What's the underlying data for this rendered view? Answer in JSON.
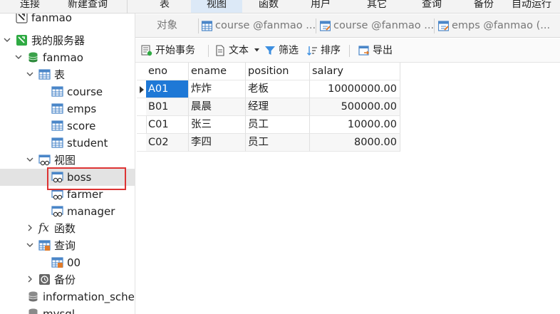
{
  "menubar": {
    "items": [
      {
        "label": "连接"
      },
      {
        "label": "新建查询"
      },
      {
        "label": "表"
      },
      {
        "label": "视图"
      },
      {
        "label": "函数"
      },
      {
        "label": "用户"
      },
      {
        "label": "其它"
      },
      {
        "label": "查询"
      },
      {
        "label": "备份"
      },
      {
        "label": "自动运行"
      }
    ],
    "active": "视图"
  },
  "sidebar": {
    "connection": "fanmao",
    "server_group": "我的服务器",
    "database": "fanmao",
    "tables_folder": "表",
    "tables": [
      "course",
      "emps",
      "score",
      "student"
    ],
    "views_folder": "视图",
    "views": [
      "boss",
      "farmer",
      "manager"
    ],
    "selected_view": "boss",
    "functions_folder": "函数",
    "queries_folder": "查询",
    "queries": [
      "00"
    ],
    "backups_folder": "备份",
    "other_databases": [
      "information_scher",
      "mysql"
    ]
  },
  "tabs": [
    {
      "label": "对象",
      "icon": "object-icon"
    },
    {
      "label": "course @fanmao ...",
      "icon": "table-icon"
    },
    {
      "label": "course @fanmao ...",
      "icon": "table-design-icon"
    },
    {
      "label": "emps @fanmao (...",
      "icon": "table-design-icon"
    }
  ],
  "toolbar": {
    "begin_transaction": "开始事务",
    "text": "文本",
    "filter": "筛选",
    "sort": "排序",
    "export": "导出"
  },
  "grid": {
    "columns": [
      "eno",
      "ename",
      "position",
      "salary"
    ],
    "rows": [
      {
        "eno": "A01",
        "ename": "炸炸",
        "position": "老板",
        "salary": "10000000.00"
      },
      {
        "eno": "B01",
        "ename": "晨晨",
        "position": "经理",
        "salary": "500000.00"
      },
      {
        "eno": "C01",
        "ename": "张三",
        "position": "员工",
        "salary": "10000.00"
      },
      {
        "eno": "C02",
        "ename": "李四",
        "position": "员工",
        "salary": "8000.00"
      }
    ]
  },
  "colors": {
    "selection": "#1e78d6",
    "highlight_box": "#d33333",
    "db_icon": "#3aa14a",
    "table_icon": "#4a86c8"
  }
}
